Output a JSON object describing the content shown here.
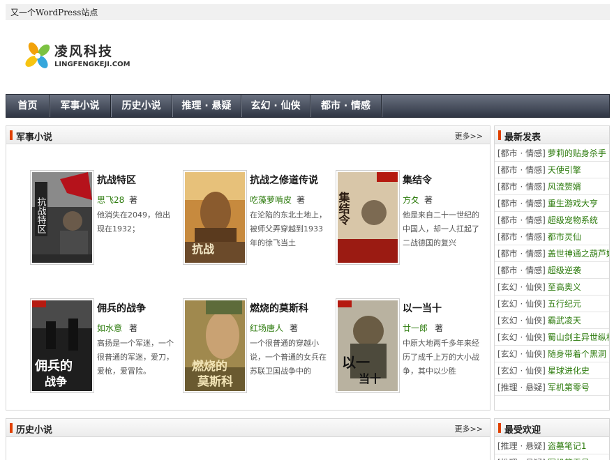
{
  "site": {
    "tagline": "又一个WordPress站点",
    "logo_cn": "凌风科技",
    "logo_en": "LINGFENGKEJI.COM"
  },
  "nav": [
    "首页",
    "军事小说",
    "历史小说",
    "推理 · 悬疑",
    "玄幻 · 仙侠",
    "都市 · 情感"
  ],
  "sections": {
    "military": {
      "title": "军事小说",
      "more": "更多>>",
      "books": [
        {
          "title": "抗战特区",
          "author": "思飞28",
          "by": "著",
          "desc": "他消失在2049，他出现在1932；"
        },
        {
          "title": "抗战之修道传说",
          "author": "吃藻萝啃皮",
          "by": "著",
          "desc": "在沦陷的东北土地上，被师父弄穿越到1933年的徐飞当土"
        },
        {
          "title": "集结令",
          "author": "方夂",
          "by": "著",
          "desc": "他是来自二十一世纪的中国人，却一人扛起了二战德国的复兴"
        },
        {
          "title": "佣兵的战争",
          "author": "如水意",
          "by": "著",
          "desc": "高扬是一个军迷，一个很普通的军迷，爱刀，爱枪，爱冒险。"
        },
        {
          "title": "燃烧的莫斯科",
          "author": "红场唐人",
          "by": "著",
          "desc": "一个很普通的穿越小说，一个普通的女兵在苏联卫国战争中的"
        },
        {
          "title": "以一当十",
          "author": "廿一郎",
          "by": "著",
          "desc": "中原大地两千多年来经历了成千上万的大小战争，其中以少胜"
        }
      ]
    },
    "history": {
      "title": "历史小说",
      "more": "更多>>"
    }
  },
  "sidebar": {
    "latest": {
      "title": "最新发表",
      "items": [
        {
          "cat": "[都市 · 情感]",
          "name": "萝莉的贴身杀手"
        },
        {
          "cat": "[都市 · 情感]",
          "name": "天使引擎"
        },
        {
          "cat": "[都市 · 情感]",
          "name": "风流赘婿"
        },
        {
          "cat": "[都市 · 情感]",
          "name": "重生游戏大亨"
        },
        {
          "cat": "[都市 · 情感]",
          "name": "超级宠物系统"
        },
        {
          "cat": "[都市 · 情感]",
          "name": "都市灵仙"
        },
        {
          "cat": "[都市 · 情感]",
          "name": "盖世神通之葫芦娃"
        },
        {
          "cat": "[都市 · 情感]",
          "name": "超级逆袭"
        },
        {
          "cat": "[玄幻 · 仙侠]",
          "name": "至高奥义"
        },
        {
          "cat": "[玄幻 · 仙侠]",
          "name": "五行纪元"
        },
        {
          "cat": "[玄幻 · 仙侠]",
          "name": "霸武凌天"
        },
        {
          "cat": "[玄幻 · 仙侠]",
          "name": "蜀山剑主异世纵横"
        },
        {
          "cat": "[玄幻 · 仙侠]",
          "name": "随身带着个黑洞"
        },
        {
          "cat": "[玄幻 · 仙侠]",
          "name": "星球进化史"
        },
        {
          "cat": "[推理 · 悬疑]",
          "name": "军机第零号"
        }
      ]
    },
    "popular": {
      "title": "最受欢迎",
      "items": [
        {
          "cat": "[推理 · 悬疑]",
          "name": "盗墓笔记1"
        },
        {
          "cat": "[推理 · 悬疑]",
          "name": "军机第零号"
        }
      ]
    }
  },
  "colors": {
    "accent": "#e04000",
    "link_green": "#2b7a0b",
    "nav_top": "#6a7180",
    "nav_bottom": "#2f3644"
  }
}
